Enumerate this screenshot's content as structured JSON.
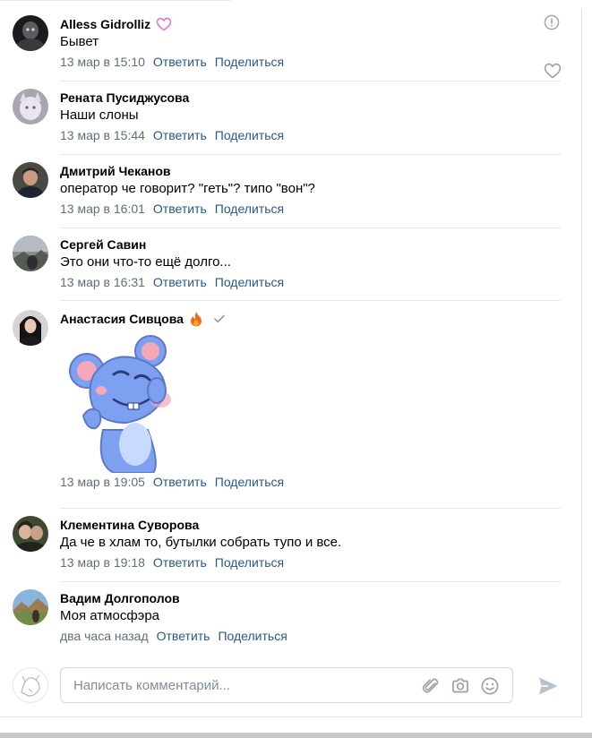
{
  "colors": {
    "link": "#2a5885",
    "meta": "#626d7a",
    "divider": "#e7e8ec",
    "icon_gray": "#99a2ad",
    "placeholder": "#818c99"
  },
  "actions": {
    "reply": "Ответить",
    "share": "Поделиться"
  },
  "comments": [
    {
      "author": "Alless Gidrolliz",
      "badge": "heart-outline-pink-icon",
      "text": "Бывет",
      "time": "13 мар в 15:10"
    },
    {
      "author": "Рената Пусиджусова",
      "text": "Наши слоны",
      "time": "13 мар в 15:44"
    },
    {
      "author": "Дмитрий Чеканов",
      "text": "оператор че говорит? \"геть\"? типо \"вон\"?",
      "time": "13 мар в 16:01"
    },
    {
      "author": "Сергей Савин",
      "text": "Это они что-то ещё долго...",
      "time": "13 мар в 16:31"
    },
    {
      "author": "Анастасия Сивцова",
      "badge": "fire-icon",
      "verified": "checkmark-icon",
      "sticker": "blue-rat-sticker",
      "time": "13 мар в 19:05"
    },
    {
      "author": "Клементина Суворова",
      "text": "Да че в хлам то, бутылки собрать тупо и все.",
      "time": "13 мар в 19:18"
    },
    {
      "author": "Вадим Долгополов",
      "text": "Моя атмосфэра",
      "time": "два часа назад"
    }
  ],
  "composer": {
    "placeholder": "Написать комментарий...",
    "icons": [
      "paperclip-icon",
      "camera-icon",
      "smile-icon",
      "send-icon"
    ]
  }
}
